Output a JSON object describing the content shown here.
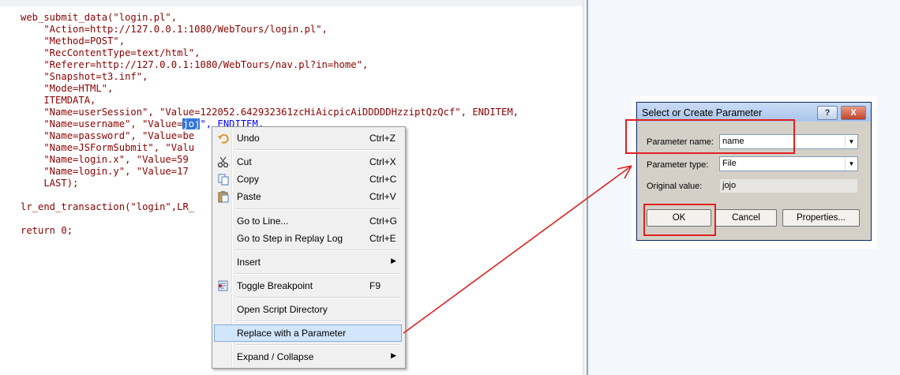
{
  "code": {
    "lines": [
      "web_submit_data(\"login.pl\",",
      "    \"Action=http://127.0.0.1:1080/WebTours/login.pl\",",
      "    \"Method=POST\",",
      "    \"RecContentType=text/html\",",
      "    \"Referer=http://127.0.0.1:1080/WebTours/nav.pl?in=home\",",
      "    \"Snapshot=t3.inf\",",
      "    \"Mode=HTML\",",
      "    ITEMDATA,",
      "    \"Name=userSession\", \"Value=122052.642932361zcHiAicpicAiDDDDDHzziptQzQcf\", ENDITEM,",
      "    \"Name=username\", \"Value=",
      "    \"Name=password\", \"Value=be",
      "    \"Name=JSFormSubmit\", \"Valu",
      "    \"Name=login.x\", \"Value=59",
      "    \"Name=login.y\", \"Value=17",
      "    LAST);",
      "",
      "lr_end_transaction(\"login\",LR_",
      "",
      "return 0;"
    ],
    "selected_text": "joj",
    "after_selection": "\", ENDITEM,"
  },
  "context_menu": {
    "items": [
      {
        "icon": "undo-icon",
        "label": "Undo",
        "shortcut": "Ctrl+Z"
      },
      {
        "icon": "cut-icon",
        "label": "Cut",
        "shortcut": "Ctrl+X"
      },
      {
        "icon": "copy-icon",
        "label": "Copy",
        "shortcut": "Ctrl+C"
      },
      {
        "icon": "paste-icon",
        "label": "Paste",
        "shortcut": "Ctrl+V"
      },
      {
        "label": "Go to Line...",
        "shortcut": "Ctrl+G"
      },
      {
        "label": "Go to Step in Replay Log",
        "shortcut": "Ctrl+E"
      },
      {
        "label": "Insert",
        "submenu": true
      },
      {
        "icon": "breakpoint-icon",
        "label": "Toggle Breakpoint",
        "shortcut": "F9"
      },
      {
        "label": "Open Script Directory"
      },
      {
        "label": "Replace with a Parameter",
        "highlighted": true
      },
      {
        "label": "Expand / Collapse",
        "submenu": true
      }
    ]
  },
  "dialog": {
    "title": "Select or Create Parameter",
    "help_label": "?",
    "close_label": "X",
    "parameter_name_label": "Parameter name:",
    "parameter_name_value": "name",
    "parameter_type_label": "Parameter type:",
    "parameter_type_value": "File",
    "original_value_label": "Original value:",
    "original_value": "jojo",
    "ok_label": "OK",
    "cancel_label": "Cancel",
    "properties_label": "Properties..."
  },
  "colors": {
    "code_string": "#8b0000",
    "code_keyword": "#0000ff",
    "selection": "#3375d6",
    "menu_highlight": "#d1e5fb",
    "annotation_red": "#e02020",
    "dialog_face": "#d4d0c8"
  }
}
